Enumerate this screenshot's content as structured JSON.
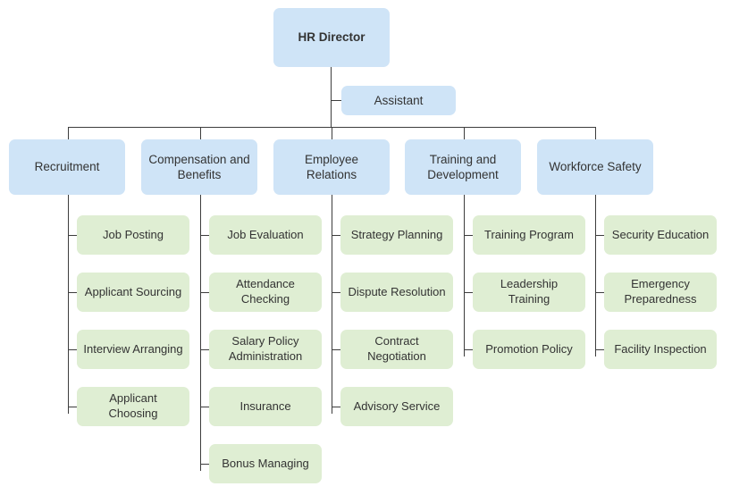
{
  "chart": {
    "type": "org-chart",
    "title": "HR Director",
    "root": {
      "label": "HR Director",
      "style": "blue"
    },
    "assistant": {
      "label": "Assistant",
      "style": "blue"
    },
    "departments": [
      {
        "label": "Recruitment",
        "style": "blue",
        "tasks": [
          {
            "label": "Job Posting"
          },
          {
            "label": "Applicant Sourcing"
          },
          {
            "label": "Interview Arranging"
          },
          {
            "label": "Applicant Choosing"
          }
        ]
      },
      {
        "label": "Compensation and Benefits",
        "style": "blue",
        "tasks": [
          {
            "label": "Job Evaluation"
          },
          {
            "label": "Attendance Checking"
          },
          {
            "label": "Salary Policy Administration"
          },
          {
            "label": "Insurance"
          },
          {
            "label": "Bonus Managing"
          }
        ]
      },
      {
        "label": "Employee Relations",
        "style": "blue",
        "tasks": [
          {
            "label": "Strategy Planning"
          },
          {
            "label": "Dispute Resolution"
          },
          {
            "label": "Contract Negotiation"
          },
          {
            "label": "Advisory Service"
          }
        ]
      },
      {
        "label": "Training and Development",
        "style": "blue",
        "tasks": [
          {
            "label": "Training Program"
          },
          {
            "label": "Leadership Training"
          },
          {
            "label": "Promotion Policy"
          }
        ]
      },
      {
        "label": "Workforce Safety",
        "style": "blue",
        "tasks": [
          {
            "label": "Security Education"
          },
          {
            "label": "Emergency Preparedness"
          },
          {
            "label": "Facility Inspection"
          }
        ]
      }
    ],
    "colors": {
      "node_blue": "#cfe4f7",
      "node_green": "#dfeed3",
      "connector": "#3d3d3d",
      "text": "#333333",
      "background": "#ffffff"
    }
  }
}
